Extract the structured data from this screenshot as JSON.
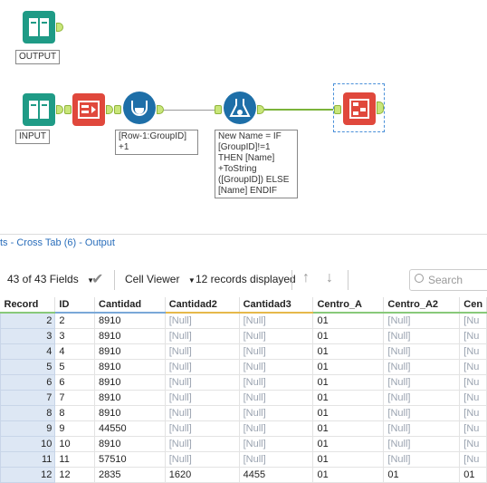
{
  "canvas": {
    "tools": {
      "output_label": "OUTPUT",
      "input_label": "INPUT",
      "formula1_label": "[Row-1:GroupID]\n+1",
      "formula2_label": "New Name = IF\n[GroupID]!=1\nTHEN [Name]\n+ToString\n([GroupID]) ELSE\n[Name] ENDIF"
    },
    "colors": {
      "input": "#1f9b86",
      "select": "#e0483c",
      "multirow": "#1e6fa8",
      "formula": "#1e6fa8",
      "crosstab": "#e0483c"
    }
  },
  "results": {
    "title": "ts - Cross Tab (6) - Output",
    "fields_label": "43 of 43 Fields",
    "cell_viewer_label": "Cell Viewer",
    "records_label": "12 records displayed",
    "search_placeholder": "Search",
    "columns": [
      "Record",
      "ID",
      "Cantidad",
      "Cantidad2",
      "Cantidad3",
      "Centro_A",
      "Centro_A2",
      "Cen"
    ],
    "rows": [
      [
        "2",
        "2",
        "8910",
        "[Null]",
        "[Null]",
        "01",
        "[Null]",
        "[Nu"
      ],
      [
        "3",
        "3",
        "8910",
        "[Null]",
        "[Null]",
        "01",
        "[Null]",
        "[Nu"
      ],
      [
        "4",
        "4",
        "8910",
        "[Null]",
        "[Null]",
        "01",
        "[Null]",
        "[Nu"
      ],
      [
        "5",
        "5",
        "8910",
        "[Null]",
        "[Null]",
        "01",
        "[Null]",
        "[Nu"
      ],
      [
        "6",
        "6",
        "8910",
        "[Null]",
        "[Null]",
        "01",
        "[Null]",
        "[Nu"
      ],
      [
        "7",
        "7",
        "8910",
        "[Null]",
        "[Null]",
        "01",
        "[Null]",
        "[Nu"
      ],
      [
        "8",
        "8",
        "8910",
        "[Null]",
        "[Null]",
        "01",
        "[Null]",
        "[Nu"
      ],
      [
        "9",
        "9",
        "44550",
        "[Null]",
        "[Null]",
        "01",
        "[Null]",
        "[Nu"
      ],
      [
        "10",
        "10",
        "8910",
        "[Null]",
        "[Null]",
        "01",
        "[Null]",
        "[Nu"
      ],
      [
        "11",
        "11",
        "57510",
        "[Null]",
        "[Null]",
        "01",
        "[Null]",
        "[Nu"
      ],
      [
        "12",
        "12",
        "2835",
        "1620",
        "4455",
        "01",
        "01",
        "01"
      ]
    ]
  }
}
